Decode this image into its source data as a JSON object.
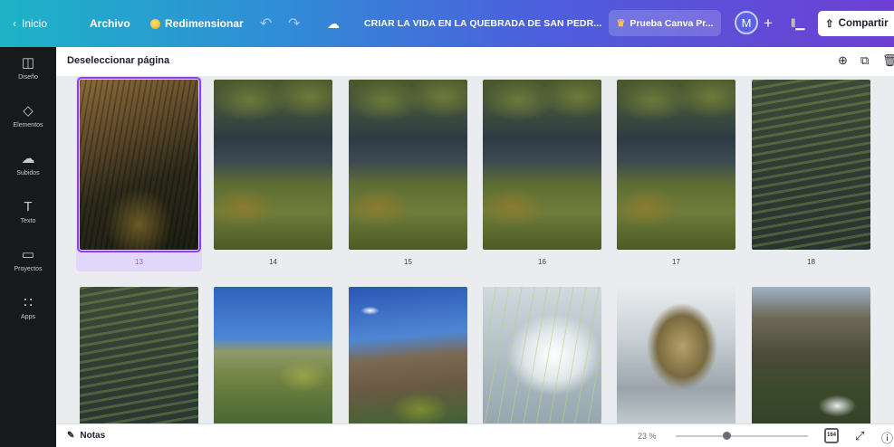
{
  "topbar": {
    "home_label": "Inicio",
    "file_label": "Archivo",
    "resize_label": "Redimensionar",
    "design_title": "CRIAR LA VIDA EN LA QUEBRADA DE SAN PEDR...",
    "trial_label": "Prueba Canva Pr...",
    "avatar_initial": "M",
    "share_label": "Compartir"
  },
  "sidebar": {
    "items": [
      {
        "label": "Diseño",
        "icon": "layout-icon"
      },
      {
        "label": "Elementos",
        "icon": "shapes-icon"
      },
      {
        "label": "Subidos",
        "icon": "cloud-upload-icon"
      },
      {
        "label": "Texto",
        "icon": "text-icon"
      },
      {
        "label": "Proyectos",
        "icon": "folder-icon"
      },
      {
        "label": "Apps",
        "icon": "apps-grid-icon"
      }
    ]
  },
  "subheader": {
    "title": "Deseleccionar página"
  },
  "pages": {
    "row1": [
      {
        "number": "13",
        "selected": true
      },
      {
        "number": "14"
      },
      {
        "number": "15"
      },
      {
        "number": "16"
      },
      {
        "number": "17"
      },
      {
        "number": "18"
      }
    ]
  },
  "bottombar": {
    "notes_label": "Notas",
    "zoom_label": "23 %",
    "zoom_level_percent": 23,
    "grid_view_badge": "164"
  },
  "colors": {
    "accent": "#8b3dff",
    "rail_bg": "#18191b",
    "canvas_bg": "#ebecf0"
  }
}
